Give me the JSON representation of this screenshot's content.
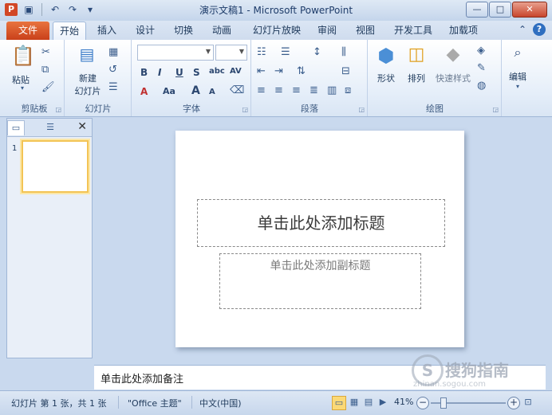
{
  "titlebar": {
    "app_icon": "P",
    "title": "演示文稿1 - Microsoft PowerPoint",
    "qat": [
      "save-icon",
      "undo-icon",
      "redo-icon",
      "customize-icon"
    ],
    "minimize": "—",
    "maximize": "□",
    "close": "✕"
  },
  "tabs": {
    "file": "文件",
    "items": [
      "开始",
      "插入",
      "设计",
      "切换",
      "动画",
      "幻灯片放映",
      "审阅",
      "视图",
      "开发工具",
      "加载项"
    ],
    "active": "开始",
    "collapse": "⌃",
    "help": "?"
  },
  "ribbon": {
    "clipboard": {
      "label": "剪贴板",
      "paste": "粘贴"
    },
    "slides": {
      "label": "幻灯片",
      "new_slide_line1": "新建",
      "new_slide_line2": "幻灯片"
    },
    "font": {
      "label": "字体",
      "bold": "B",
      "italic": "I",
      "underline": "U",
      "strike": "S",
      "shadow": "abc",
      "spacing": "AV",
      "aa": "Aa",
      "grow": "A",
      "shrink": "A",
      "color": "A"
    },
    "paragraph": {
      "label": "段落"
    },
    "drawing": {
      "label": "绘图",
      "shape": "形状",
      "arrange": "排列",
      "quick_styles": "快速样式"
    },
    "editing": {
      "label": "编辑"
    }
  },
  "slides_pane": {
    "slide_number": "1",
    "close": "✕"
  },
  "slide": {
    "title_placeholder": "单击此处添加标题",
    "subtitle_placeholder": "单击此处添加副标题"
  },
  "notes": {
    "placeholder": "单击此处添加备注"
  },
  "watermark": {
    "logo": "S",
    "text": "搜狗指南",
    "url": "zhinan.sogou.com"
  },
  "status": {
    "slide_info": "幻灯片 第 1 张，共 1 张",
    "theme": "\"Office 主题\"",
    "language": "中文(中国)",
    "zoom": "41%"
  }
}
